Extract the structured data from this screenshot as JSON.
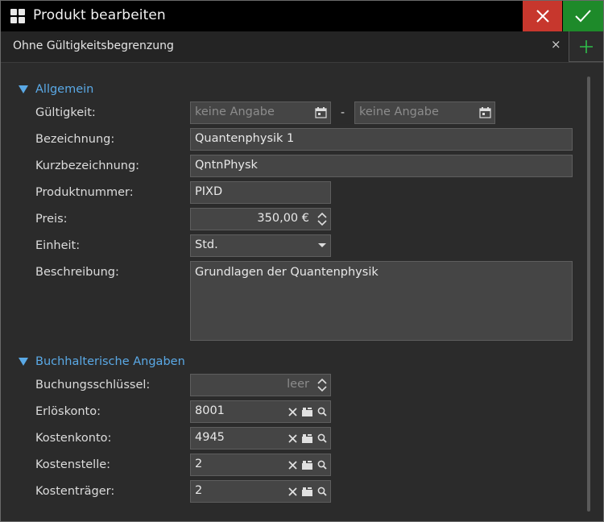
{
  "window": {
    "title": "Produkt bearbeiten"
  },
  "tab": {
    "label": "Ohne Gültigkeitsbegrenzung",
    "close_glyph": "×"
  },
  "sections": {
    "general": "Allgemein",
    "accounting": "Buchhalterische Angaben"
  },
  "labels": {
    "validity": "Gültigkeit:",
    "name": "Bezeichnung:",
    "short_name": "Kurzbezeichnung:",
    "product_no": "Produktnummer:",
    "price": "Preis:",
    "unit": "Einheit:",
    "description": "Beschreibung:",
    "booking_key": "Buchungsschlüssel:",
    "revenue_account": "Erlöskonto:",
    "cost_account": "Kostenkonto:",
    "cost_center": "Kostenstelle:",
    "cost_unit": "Kostenträger:"
  },
  "fields": {
    "validity_from_placeholder": "keine Angabe",
    "validity_separator": "-",
    "validity_to_placeholder": "keine Angabe",
    "name": "Quantenphysik 1",
    "short_name": "QntnPhysk",
    "product_no": "PIXD",
    "price": "350,00 €",
    "unit": "Std.",
    "description": "Grundlagen der Quantenphysik",
    "booking_key_placeholder": "leer",
    "revenue_account": "8001",
    "cost_account": "4945",
    "cost_center": "2",
    "cost_unit": "2"
  },
  "colors": {
    "accent": "#5aa9e6",
    "cancel": "#c7372d",
    "confirm": "#1e8a2a",
    "add": "#2fbf4a"
  }
}
